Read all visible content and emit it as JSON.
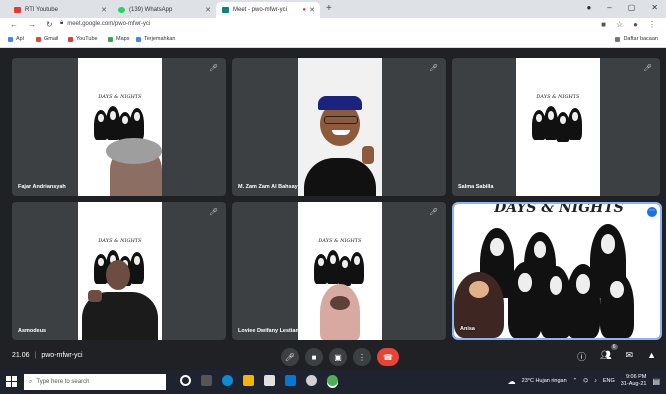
{
  "browser": {
    "tabs": [
      {
        "label": "RTI Youtube",
        "fav": "#e53935"
      },
      {
        "label": "(139) WhatsApp",
        "fav": "#25d366"
      },
      {
        "label": "Meet - pwo-mfwr-yci",
        "fav": "#00897b"
      }
    ],
    "url": "meet.google.com/pwo-mfwr-yci",
    "bookmarks": [
      "Apl",
      "Gmail",
      "YouTube",
      "Maps",
      "Terjemahkan"
    ],
    "reading_list": "Daftar bacaan"
  },
  "meet": {
    "poster_title": "DAYS & NIGHTS",
    "participants": [
      {
        "name": "Fajar Andriansyah"
      },
      {
        "name": "M. Zam Zam Al Bahsay"
      },
      {
        "name": "Salma Sabilla"
      },
      {
        "name": "Asmodeus"
      },
      {
        "name": "Loviee Dwifany Lestiana Biry"
      },
      {
        "name": "Anisa"
      }
    ],
    "time": "21.06",
    "meeting_code": "pwo-mfwr-yci",
    "participant_count": "6"
  },
  "taskbar": {
    "search_placeholder": "Type here to search",
    "weather": "23°C Hujan ringan",
    "lang": "ENG",
    "time": "9:06 PM",
    "date": "31-Aug-21"
  },
  "colors": {
    "end_call": "#ea4335",
    "accent": "#1a73e8",
    "stage": "#202124"
  },
  "icons": [
    "mic-icon",
    "camera-icon",
    "present-icon",
    "more-icon",
    "end-call-icon",
    "info-icon",
    "people-icon",
    "chat-icon",
    "activities-icon"
  ]
}
